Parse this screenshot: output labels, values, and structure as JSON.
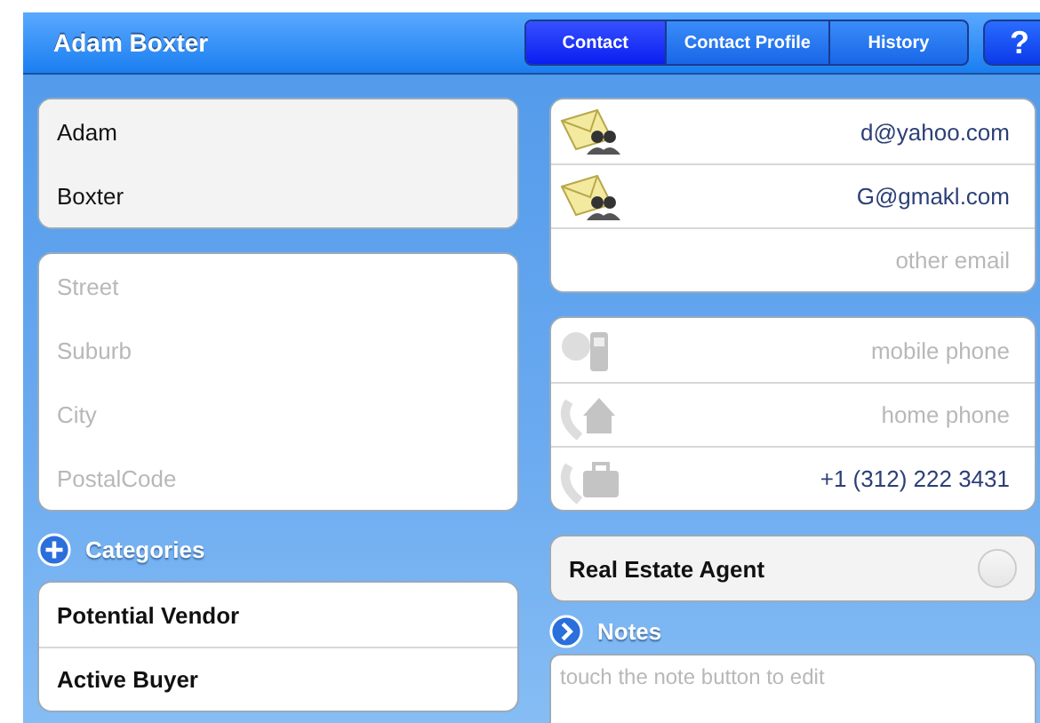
{
  "header": {
    "title": "Adam Boxter",
    "help": "?"
  },
  "tabs": [
    {
      "label": "Contact",
      "selected": true
    },
    {
      "label": "Contact Profile",
      "selected": false
    },
    {
      "label": "History",
      "selected": false
    }
  ],
  "name_fields": [
    {
      "value": "Adam"
    },
    {
      "value": "Boxter"
    }
  ],
  "address_fields": [
    {
      "placeholder": "Street"
    },
    {
      "placeholder": "Suburb"
    },
    {
      "placeholder": "City"
    },
    {
      "placeholder": "PostalCode"
    }
  ],
  "categories": {
    "label": "Categories",
    "items": [
      "Potential Vendor",
      "Active Buyer"
    ]
  },
  "emails": [
    {
      "value": "d@yahoo.com"
    },
    {
      "value": "G@gmakl.com"
    },
    {
      "placeholder": "other email"
    }
  ],
  "phones": [
    {
      "kind": "mobile",
      "placeholder": "mobile phone"
    },
    {
      "kind": "home",
      "placeholder": "home phone"
    },
    {
      "kind": "work",
      "value": "+1 (312) 222 3431"
    }
  ],
  "agent": {
    "label": "Real Estate Agent",
    "checked": false
  },
  "notes": {
    "label": "Notes",
    "placeholder": "touch the note button to edit"
  }
}
